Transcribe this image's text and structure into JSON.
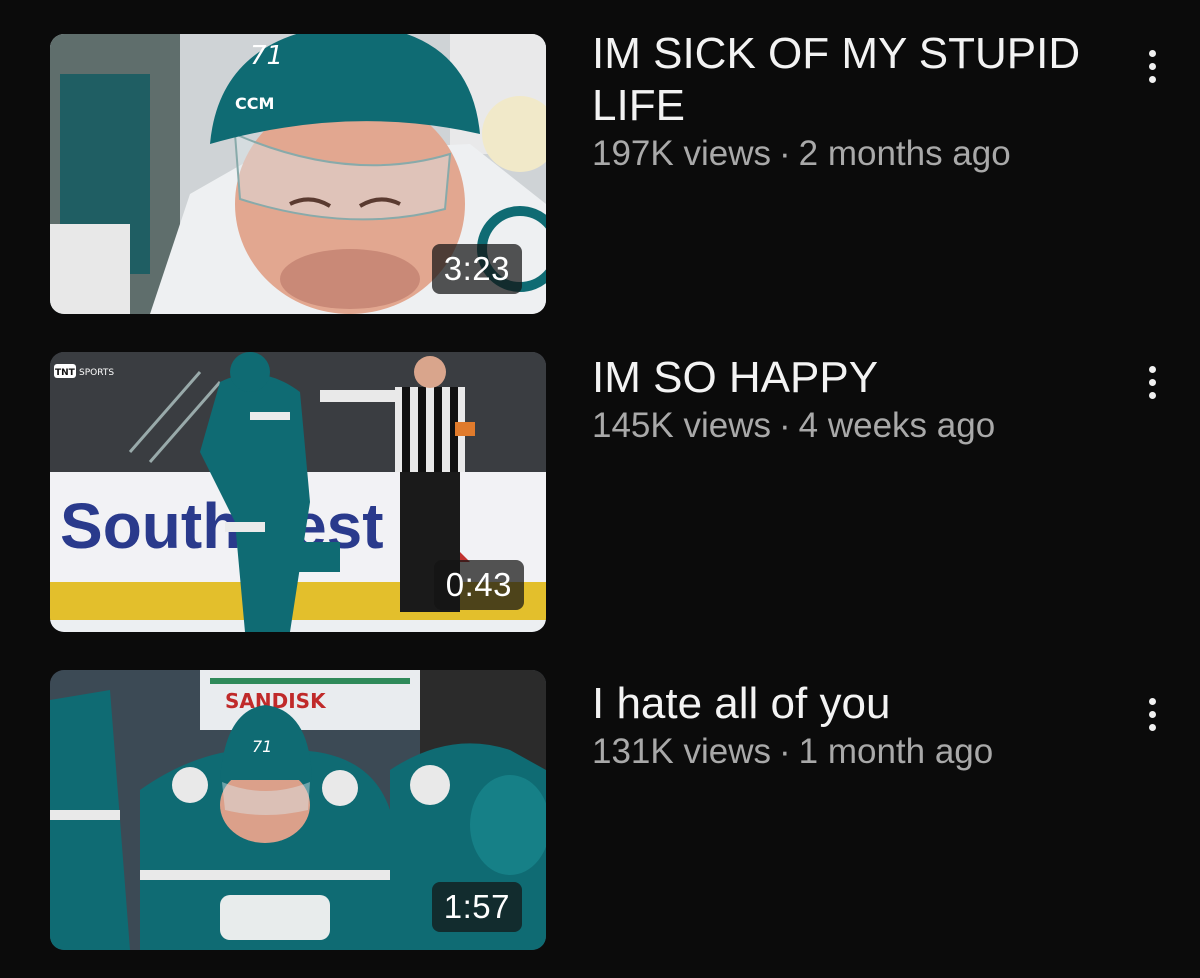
{
  "videos": [
    {
      "title": "IM SICK OF MY STUPID LIFE",
      "views": "197K views",
      "age": "2 months ago",
      "duration": "3:23",
      "thumbnail_icon": "hockey-player-closeup-thumbnail",
      "helmet_number": "71",
      "helmet_brand": "CCM"
    },
    {
      "title": "IM SO HAPPY",
      "views": "145K views",
      "age": "4 weeks ago",
      "duration": "0:43",
      "thumbnail_icon": "hockey-celebration-thumbnail",
      "broadcaster_logo": "TNT SPORTS",
      "board_ad": "Southwest"
    },
    {
      "title": "I hate all of you",
      "views": "131K views",
      "age": "1 month ago",
      "duration": "1:57",
      "thumbnail_icon": "hockey-bench-thumbnail",
      "board_ad": "SANDISK"
    }
  ],
  "separator": "·",
  "colors": {
    "background": "#0b0b0b",
    "title": "#f3f3f3",
    "meta": "#a9a9a9",
    "sharks_teal": "#0f6b73"
  }
}
